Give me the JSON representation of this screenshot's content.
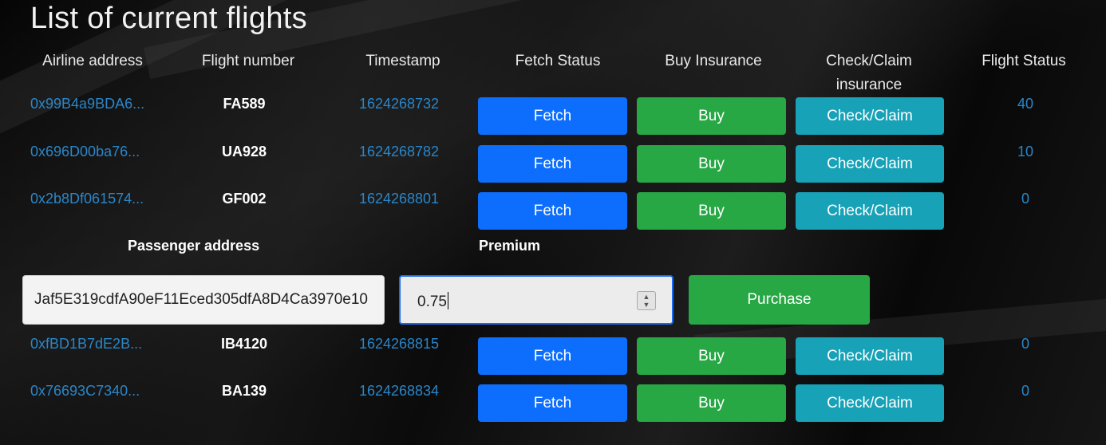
{
  "page": {
    "title": "List of current flights"
  },
  "headers": {
    "airline_address": "Airline address",
    "flight_number": "Flight number",
    "timestamp": "Timestamp",
    "fetch_status": "Fetch Status",
    "buy_insurance": "Buy Insurance",
    "check_claim": "Check/Claim insurance",
    "flight_status": "Flight Status"
  },
  "flights": [
    {
      "airline": "0x99B4a9BDA6...",
      "flight": "FA589",
      "timestamp": "1624268732",
      "fetch_label": "Fetch",
      "buy_label": "Buy",
      "check_label": "Check/Claim",
      "status": "40"
    },
    {
      "airline": "0x696D00ba76...",
      "flight": "UA928",
      "timestamp": "1624268782",
      "fetch_label": "Fetch",
      "buy_label": "Buy",
      "check_label": "Check/Claim",
      "status": "10"
    },
    {
      "airline": "0x2b8Df061574...",
      "flight": "GF002",
      "timestamp": "1624268801",
      "fetch_label": "Fetch",
      "buy_label": "Buy",
      "check_label": "Check/Claim",
      "status": "0"
    },
    {
      "airline": "0xfBD1B7dE2B...",
      "flight": "IB4120",
      "timestamp": "1624268815",
      "fetch_label": "Fetch",
      "buy_label": "Buy",
      "check_label": "Check/Claim",
      "status": "0"
    },
    {
      "airline": "0x76693C7340...",
      "flight": "BA139",
      "timestamp": "1624268834",
      "fetch_label": "Fetch",
      "buy_label": "Buy",
      "check_label": "Check/Claim",
      "status": "0"
    }
  ],
  "purchase_form": {
    "passenger_label": "Passenger address",
    "passenger_value": "Jaf5E319cdfA90eF11Eced305dfA8D4Ca3970e10",
    "premium_label": "Premium",
    "premium_value": "0.75",
    "purchase_label": "Purchase"
  },
  "icons": {
    "spinner_up": "chevron-up-icon",
    "spinner_down": "chevron-down-icon"
  },
  "colors": {
    "fetch_button": "#0d6efd",
    "buy_button": "#28a745",
    "check_button": "#17a2b8",
    "link_text": "#2a86c9",
    "focus_border": "#1a6df2"
  }
}
